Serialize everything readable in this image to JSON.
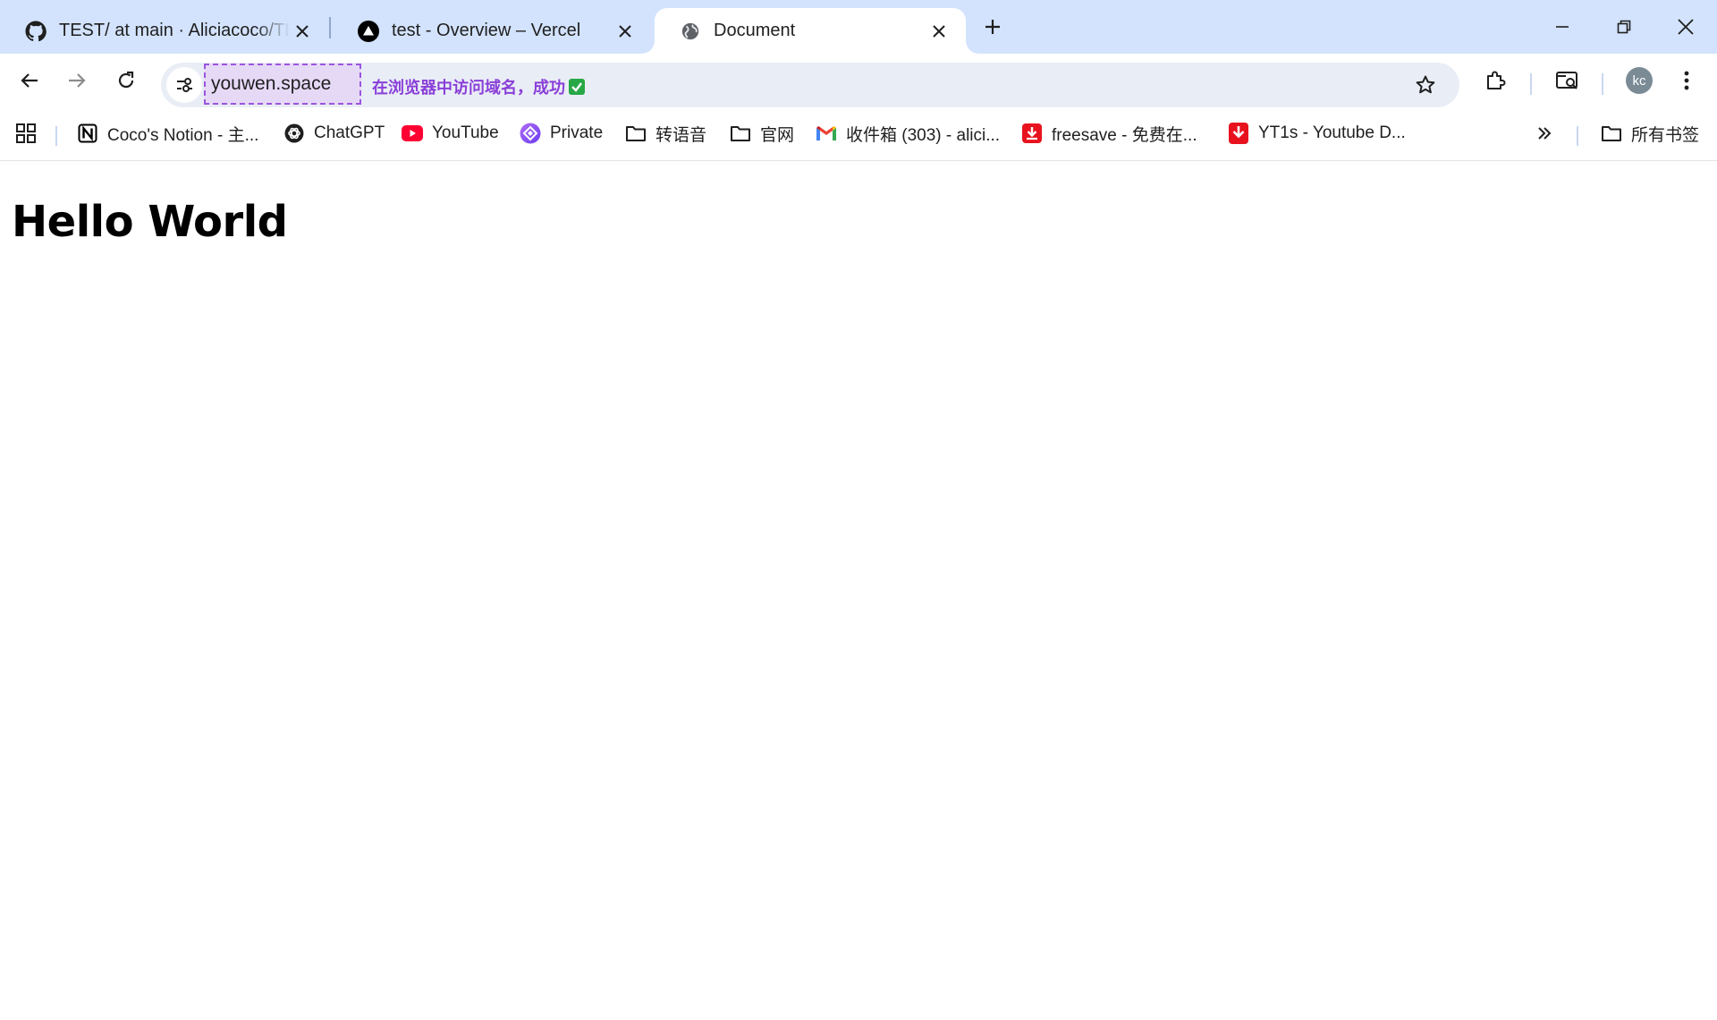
{
  "tabs": [
    {
      "title": "TEST/ at main · Aliciacoco/TEST",
      "icon": "github-icon",
      "active": false
    },
    {
      "title": "test - Overview – Vercel",
      "icon": "vercel-icon",
      "active": false
    },
    {
      "title": "Document",
      "icon": "globe-icon",
      "active": true
    }
  ],
  "omnibox": {
    "url": "youwen.space",
    "annotation": "在浏览器中访问域名，成功",
    "annotation_color": "#8a3fd8"
  },
  "toolbar": {
    "profile_initials": "kc"
  },
  "bookmarks": [
    {
      "label": "Coco's Notion - 主...",
      "icon": "notion-icon"
    },
    {
      "label": "ChatGPT",
      "icon": "chatgpt-icon"
    },
    {
      "label": "YouTube",
      "icon": "youtube-icon"
    },
    {
      "label": "Private",
      "icon": "private-icon"
    },
    {
      "label": "转语音",
      "icon": "folder-icon"
    },
    {
      "label": "官网",
      "icon": "folder-icon"
    },
    {
      "label": "收件箱 (303) - alici...",
      "icon": "gmail-icon"
    },
    {
      "label": "freesave - 免费在...",
      "icon": "freesave-icon"
    },
    {
      "label": "YT1s - Youtube D...",
      "icon": "yt1s-icon"
    }
  ],
  "all_bookmarks_label": "所有书签",
  "page": {
    "heading": "Hello World"
  }
}
